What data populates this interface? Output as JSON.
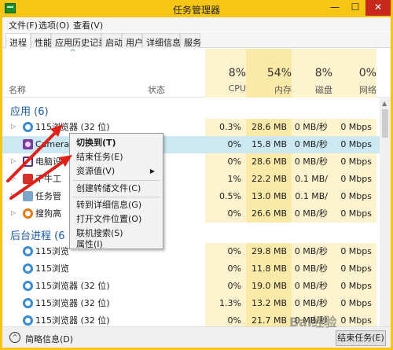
{
  "window": {
    "title": "任务管理器",
    "minimize": "—",
    "maximize": "☐",
    "close": "✕"
  },
  "menu": [
    "文件(F)",
    "选项(O)",
    "查看(V)"
  ],
  "tabs": [
    "进程",
    "性能",
    "应用历史记录",
    "启动",
    "用户",
    "详细信息",
    "服务"
  ],
  "columns": {
    "name": "名称",
    "status": "状态",
    "cpu": {
      "pct": "8%",
      "label": "CPU"
    },
    "memory": {
      "pct": "54%",
      "label": "内存"
    },
    "disk": {
      "pct": "8%",
      "label": "磁盘"
    },
    "network": {
      "pct": "0%",
      "label": "网络"
    }
  },
  "groups": {
    "apps": "应用 (6)",
    "background": "后台进程 (6"
  },
  "rows": [
    {
      "name": "115浏览器 (32 位)",
      "cpu": "0.3%",
      "mem": "28.6 MB",
      "disk": "0 MB/秒",
      "net": "0 Mbps"
    },
    {
      "name": "Camera",
      "cpu": "0%",
      "mem": "15.8 MB",
      "disk": "0 MB/秒",
      "net": "0 Mbps"
    },
    {
      "name": "电脑设",
      "cpu": "0%",
      "mem": "28.6 MB",
      "disk": "0 MB/秒",
      "net": "0 Mbps"
    },
    {
      "name": "千牛工",
      "cpu": "1%",
      "mem": "22.2 MB",
      "disk": "0.1 MB/秒",
      "net": "0 Mbps"
    },
    {
      "name": "任务管",
      "cpu": "0.5%",
      "mem": "13.0 MB",
      "disk": "0.1 MB/秒",
      "net": "0 Mbps"
    },
    {
      "name": "搜狗高",
      "cpu": "0%",
      "mem": "26.6 MB",
      "disk": "0 MB/秒",
      "net": "0 Mbps"
    },
    {
      "name": "115浏览",
      "cpu": "0%",
      "mem": "29.8 MB",
      "disk": "0 MB/秒",
      "net": "0 Mbps"
    },
    {
      "name": "115浏览",
      "cpu": "0%",
      "mem": "11.8 MB",
      "disk": "0 MB/秒",
      "net": "0 Mbps"
    },
    {
      "name": "115浏览器 (32 位)",
      "cpu": "0%",
      "mem": "19.0 MB",
      "disk": "0 MB/秒",
      "net": "0 Mbps"
    },
    {
      "name": "115浏览器 (32 位)",
      "cpu": "1.3%",
      "mem": "13.2 MB",
      "disk": "0 MB/秒",
      "net": "0 Mbps"
    },
    {
      "name": "115浏览器 (32 位)",
      "cpu": "0%",
      "mem": "21.7 MB",
      "disk": "0 MB/秒",
      "net": "0 Mbps"
    }
  ],
  "context_menu": {
    "switch_to": "切换到(T)",
    "end_task": "结束任务(E)",
    "resource_values": "资源值(V)",
    "create_dump": "创建转储文件(C)",
    "go_to_details": "转到详细信息(G)",
    "open_file_location": "打开文件位置(O)",
    "search_online": "联机搜索(S)",
    "properties": "属性(I)"
  },
  "footer": {
    "fewer_details": "简略信息(D)",
    "end_task_button": "结束任务(E)"
  },
  "watermark": "Bai经验",
  "colors": {
    "heat_light": "#fdf3cf",
    "heat_medium": "#fbe9a8",
    "selected": "#cce8f3",
    "group_title": "#1a5aa8",
    "annotation_arrow": "#e0211a"
  }
}
